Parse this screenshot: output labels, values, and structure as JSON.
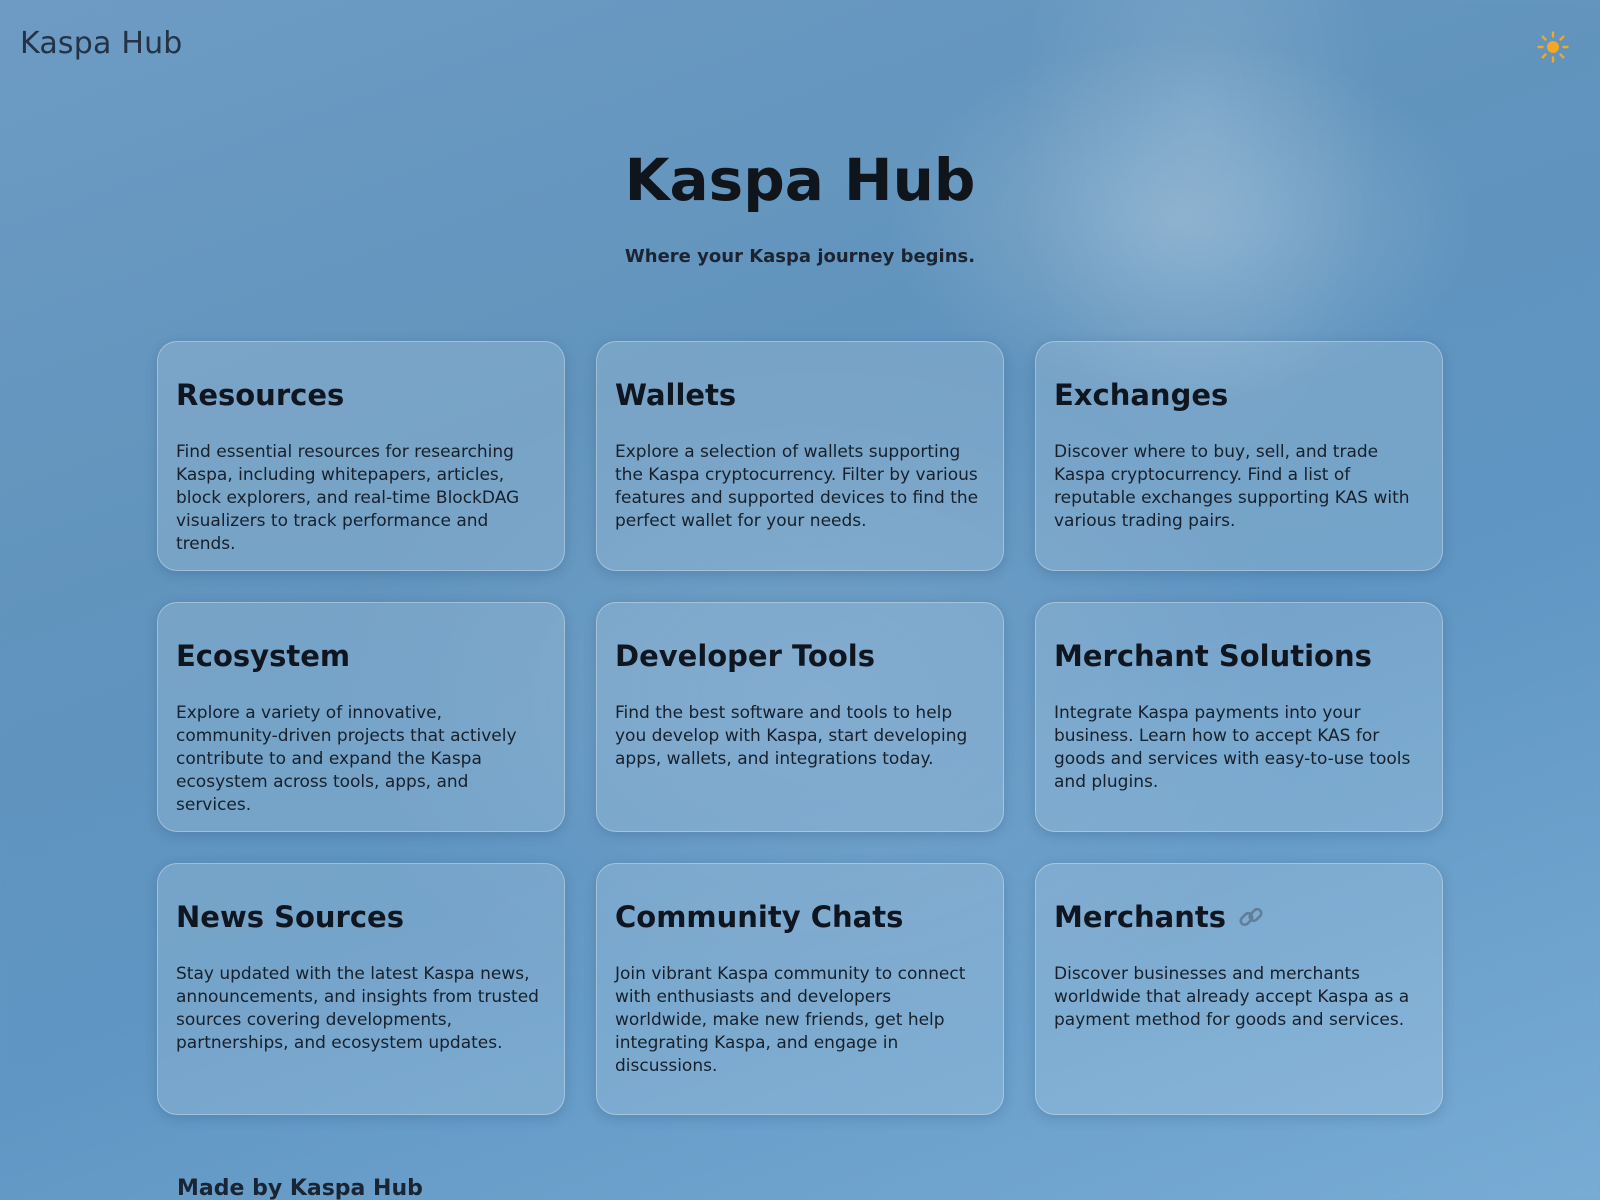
{
  "header": {
    "brand": "Kaspa Hub",
    "theme_toggle_icon": "sun-icon",
    "accent_color": "#f5a623"
  },
  "hero": {
    "title": "Kaspa Hub",
    "subtitle": "Where your Kaspa journey begins."
  },
  "cards": [
    {
      "title": "Resources",
      "description": "Find essential resources for researching Kaspa, including whitepapers, articles, block explorers, and real-time BlockDAG visualizers to track performance and trends."
    },
    {
      "title": "Wallets",
      "description": "Explore a selection of wallets supporting the Kaspa cryptocurrency. Filter by various features and supported devices to find the perfect wallet for your needs."
    },
    {
      "title": "Exchanges",
      "description": "Discover where to buy, sell, and trade Kaspa cryptocurrency. Find a list of reputable exchanges supporting KAS with various trading pairs."
    },
    {
      "title": "Ecosystem",
      "description": "Explore a variety of innovative, community-driven projects that actively contribute to and expand the Kaspa ecosystem across tools, apps, and services."
    },
    {
      "title": "Developer Tools",
      "description": "Find the best software and tools to help you develop with Kaspa, start developing apps, wallets, and integrations today."
    },
    {
      "title": "Merchant Solutions",
      "description": "Integrate Kaspa payments into your business. Learn how to accept KAS for goods and services with easy-to-use tools and plugins."
    },
    {
      "title": "News Sources",
      "description": "Stay updated with the latest Kaspa news, announcements, and insights from trusted sources covering developments, partnerships, and ecosystem updates."
    },
    {
      "title": "Community Chats",
      "description": "Join vibrant Kaspa community to connect with enthusiasts and developers worldwide, make new friends, get help integrating Kaspa, and engage in discussions."
    },
    {
      "title": "Merchants",
      "title_icon": "link-icon",
      "description": "Discover businesses and merchants worldwide that already accept Kaspa as a payment method for goods and services."
    }
  ],
  "footer": {
    "text": "Made by Kaspa Hub"
  }
}
